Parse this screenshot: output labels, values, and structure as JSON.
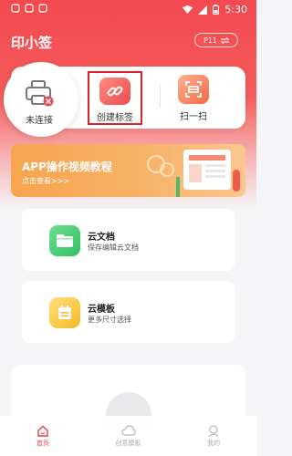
{
  "status": {
    "time": "5:30"
  },
  "app": {
    "title": "印小签",
    "printer_model": "P11"
  },
  "actions": [
    {
      "label": "未连接"
    },
    {
      "label": "创建标签"
    },
    {
      "label": "扫一扫"
    }
  ],
  "banner": {
    "title": "APP操作视频教程",
    "subtitle": "点击查看>>>"
  },
  "features": [
    {
      "title": "云文档",
      "subtitle": "保存编辑云文档"
    },
    {
      "title": "云模板",
      "subtitle": "更多尺寸选择"
    }
  ],
  "tabs": [
    {
      "label": "首页",
      "active": true
    },
    {
      "label": "创意模板",
      "active": false
    },
    {
      "label": "我的",
      "active": false
    }
  ],
  "colors": {
    "brand": "#f24a50",
    "banner": "#f7a44d",
    "highlight": "#e0202a"
  }
}
